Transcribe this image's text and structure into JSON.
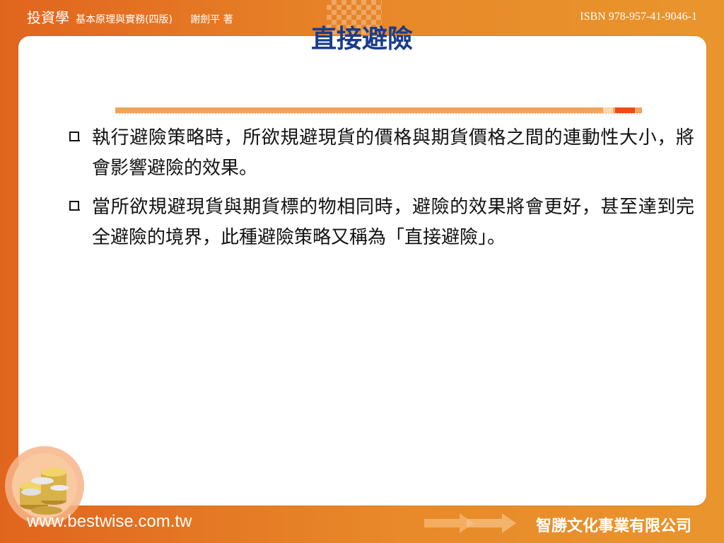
{
  "header": {
    "book_title": "投資學",
    "book_subtitle": "基本原理與實務(四版)",
    "author": "謝劍平 著",
    "isbn": "ISBN 978-957-41-9046-1"
  },
  "slide": {
    "title": "直接避險",
    "bullets": [
      "執行避險策略時，所欲規避現貨的價格與期貨價格之間的連動性大小，將會影響避險的效果。",
      "當所欲規避現貨與期貨標的物相同時，避險的效果將會更好，甚至達到完全避險的境界，此種避險策略又稱為「直接避險」。"
    ]
  },
  "footer": {
    "url": "www.bestwise.com.tw",
    "publisher": "智勝文化事業有限公司"
  },
  "colors": {
    "accent_orange": "#e8892a",
    "title_blue": "#1a3d8a",
    "bar_red": "#f04a14"
  },
  "icons": {
    "logo": "coin-stack-icon",
    "bullet": "checkbox-square-icon",
    "footer_arrows": "arrow-right-icon"
  }
}
